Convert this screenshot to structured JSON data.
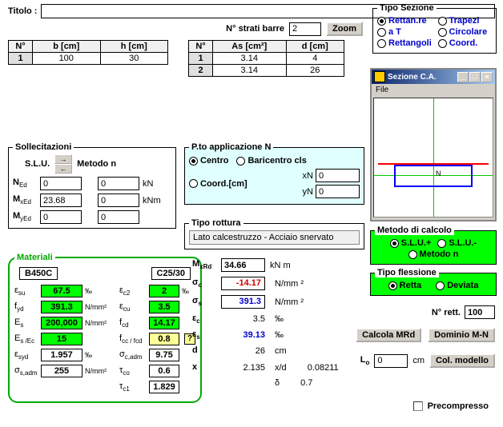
{
  "title_label": "Titolo :",
  "title_value": "",
  "strati": {
    "label": "N° strati barre",
    "value": "2",
    "zoom": "Zoom"
  },
  "tipo_sezione": {
    "legend": "Tipo Sezione",
    "opts": [
      "Rettan.re",
      "Trapezi",
      "a T",
      "Circolare",
      "Rettangoli",
      "Coord."
    ],
    "selected": 0
  },
  "tbl1": {
    "headers": [
      "N°",
      "b  [cm]",
      "h  [cm]"
    ],
    "rows": [
      [
        "1",
        "100",
        "30"
      ]
    ]
  },
  "tbl2": {
    "headers": [
      "N°",
      "As [cm²]",
      "d [cm]"
    ],
    "rows": [
      [
        "1",
        "3.14",
        "4"
      ],
      [
        "2",
        "3.14",
        "26"
      ]
    ]
  },
  "sezione_win": {
    "title": "Sezione C.A.",
    "file": "File",
    "n_label": "N"
  },
  "sollec": {
    "legend": "Sollecitazioni",
    "slu": "S.L.U.",
    "metodo": "Metodo n",
    "rows": [
      {
        "lab": "N",
        "sub": "Ed",
        "v1": "0",
        "v2": "0",
        "unit": "kN"
      },
      {
        "lab": "M",
        "sub": "xEd",
        "v1": "23.68",
        "v2": "0",
        "unit": "kNm"
      },
      {
        "lab": "M",
        "sub": "yEd",
        "v1": "0",
        "v2": "0",
        "unit": ""
      }
    ]
  },
  "pto": {
    "legend": "P.to applicazione N",
    "centro": "Centro",
    "bari": "Baricentro cls",
    "coord": "Coord.[cm]",
    "xn": "xN",
    "yn": "yN",
    "xv": "0",
    "yv": "0",
    "selected": 0
  },
  "tipo_rot": {
    "legend": "Tipo rottura",
    "text": "Lato calcestruzzo - Acciaio snervato"
  },
  "materiali": {
    "legend": "Materiali",
    "steel": "B450C",
    "conc": "C25/30",
    "rows": [
      {
        "l1": "ε",
        "s1": "su",
        "v1": "67.5",
        "u1": "‰",
        "l2": "ε",
        "s2": "c2",
        "v2": "2",
        "u2": "‰",
        "c2": "g"
      },
      {
        "l1": "f",
        "s1": "yd",
        "v1": "391.3",
        "u1": "N/mm²",
        "l2": "ε",
        "s2": "cu",
        "v2": "3.5",
        "u2": "",
        "c2": "g"
      },
      {
        "l1": "E",
        "s1": "s",
        "v1": "200,000",
        "u1": "N/mm²",
        "l2": "f",
        "s2": "cd",
        "v2": "14.17",
        "u2": "",
        "c2": "g"
      },
      {
        "l1": "E",
        "s1": "s /Ec",
        "v1": "15",
        "u1": "",
        "l2": "f",
        "s2": "cc / fcd",
        "v2": "0.8",
        "u2": "",
        "c2": "y",
        "q": true
      },
      {
        "l1": "ε",
        "s1": "syd",
        "v1": "1.957",
        "u1": "‰",
        "l2": "σ",
        "s2": "c,adm",
        "v2": "9.75",
        "u2": "",
        "c1": "w",
        "c2": "w"
      },
      {
        "l1": "σ",
        "s1": "s,adm",
        "v1": "255",
        "u1": "N/mm²",
        "l2": "τ",
        "s2": "co",
        "v2": "0.6",
        "u2": "",
        "c1": "w",
        "c2": "w"
      },
      {
        "l1": "",
        "s1": "",
        "v1": "",
        "u1": "",
        "l2": "τ",
        "s2": "c1",
        "v2": "1.829",
        "u2": "",
        "c2": "w"
      }
    ]
  },
  "results": {
    "mxrd": {
      "l": "M",
      "s": "xRd",
      "v": "34.66",
      "u": "kN m"
    },
    "rows": [
      {
        "l": "σ",
        "s": "c",
        "v": "-14.17",
        "u": "N/mm ²",
        "cls": "red",
        "boxed": true
      },
      {
        "l": "σ",
        "s": "s",
        "v": "391.3",
        "u": "N/mm ²",
        "cls": "blue",
        "boxed": true
      },
      {
        "l": "ε",
        "s": "c",
        "v": "3.5",
        "u": "‰"
      },
      {
        "l": "ε",
        "s": "s",
        "v": "39.13",
        "u": "‰",
        "cls": "blue"
      },
      {
        "l": "d",
        "s": "",
        "v": "26",
        "u": "cm"
      },
      {
        "l": "x",
        "s": "",
        "v": "2.135",
        "u": "x/d",
        "extra": "0.08211"
      },
      {
        "l": "",
        "s": "",
        "v": "",
        "u": "δ",
        "extra": "0.7"
      }
    ]
  },
  "metodo_calc": {
    "legend": "Metodo di calcolo",
    "o1": "S.L.U.+",
    "o2": "S.L.U.-",
    "o3": "Metodo n",
    "sel": 0
  },
  "tipo_fless": {
    "legend": "Tipo flessione",
    "o1": "Retta",
    "o2": "Deviata",
    "sel": 0
  },
  "nrett": {
    "label": "N° rett.",
    "v": "100"
  },
  "buttons": {
    "calc": "Calcola MRd",
    "dom": "Dominio M-N",
    "col": "Col. modello"
  },
  "lo": {
    "label": "L",
    "sub": "o",
    "v": "0",
    "u": "cm"
  },
  "precom": "Precompresso"
}
